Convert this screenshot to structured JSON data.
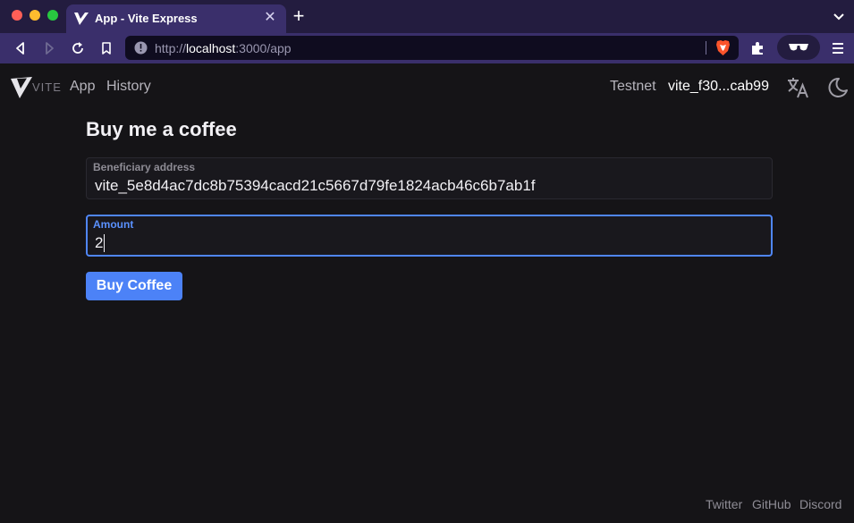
{
  "browser": {
    "tab": {
      "title": "App - Vite Express",
      "close_icon": "close-icon"
    },
    "address_bar": {
      "prefix": "http://",
      "host": "localhost",
      "rest": ":3000/app"
    },
    "colors": {
      "titlebar": "#231c3f",
      "toolbar": "#3a2f6b",
      "brave_orange": "#fb542b"
    }
  },
  "header": {
    "logo_text": "VITE",
    "nav": {
      "app": "App",
      "history": "History"
    },
    "network": "Testnet",
    "account": "vite_f30...cab99"
  },
  "main": {
    "title": "Buy me a coffee",
    "beneficiary": {
      "label": "Beneficiary address",
      "value": "vite_5e8d4ac7dc8b75394cacd21c5667d79fe1824acb46c6b7ab1f"
    },
    "amount": {
      "label": "Amount",
      "value": "2"
    },
    "submit_label": "Buy Coffee"
  },
  "footer": {
    "twitter": "Twitter",
    "github": "GitHub",
    "discord": "Discord"
  },
  "colors": {
    "accent": "#4c82f7",
    "background": "#151417"
  }
}
